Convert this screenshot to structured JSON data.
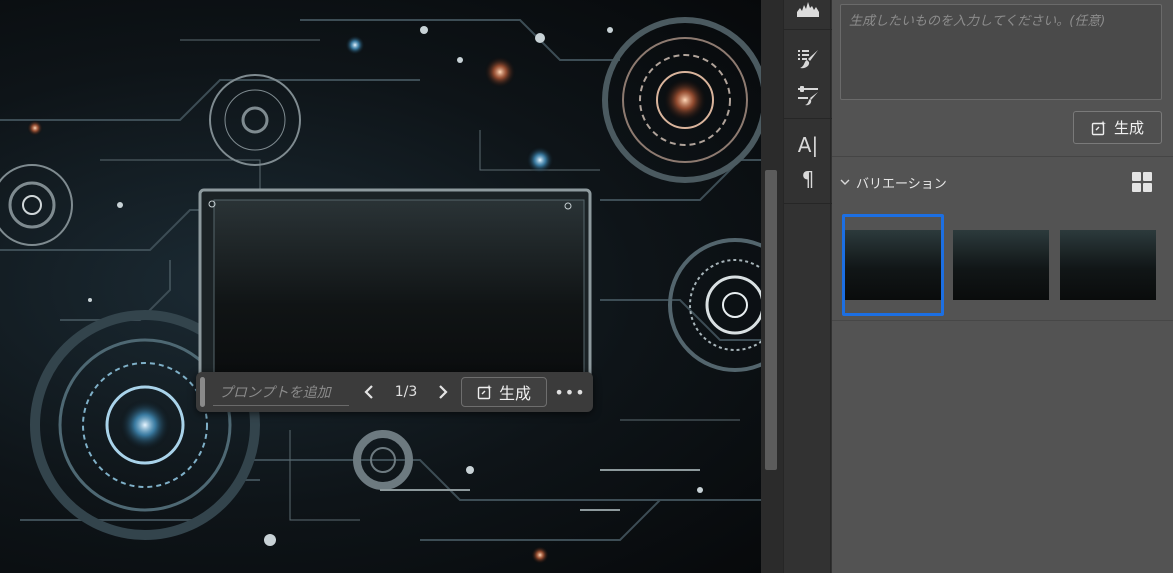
{
  "canvas": {
    "taskbar": {
      "prompt_placeholder": "プロンプトを追加",
      "counter": "1/3",
      "generate_label": "生成",
      "more_label": "•••"
    }
  },
  "toolstrip": {
    "tools": [
      {
        "name": "histogram-icon"
      },
      {
        "name": "brush-settings-icon"
      },
      {
        "name": "adjustments-icon"
      },
      {
        "name": "character-icon",
        "glyph": "A|"
      },
      {
        "name": "paragraph-icon",
        "glyph": "¶"
      }
    ]
  },
  "panel": {
    "prompt_placeholder": "生成したいものを入力してください。(任意)",
    "generate_label": "生成",
    "variations_label": "バリエーション",
    "variations": [
      {
        "selected": true
      },
      {
        "selected": false
      },
      {
        "selected": false
      }
    ]
  },
  "colors": {
    "accent": "#1c6fe3",
    "panel_bg": "#535353",
    "taskbar_bg": "#3b3b3b"
  }
}
